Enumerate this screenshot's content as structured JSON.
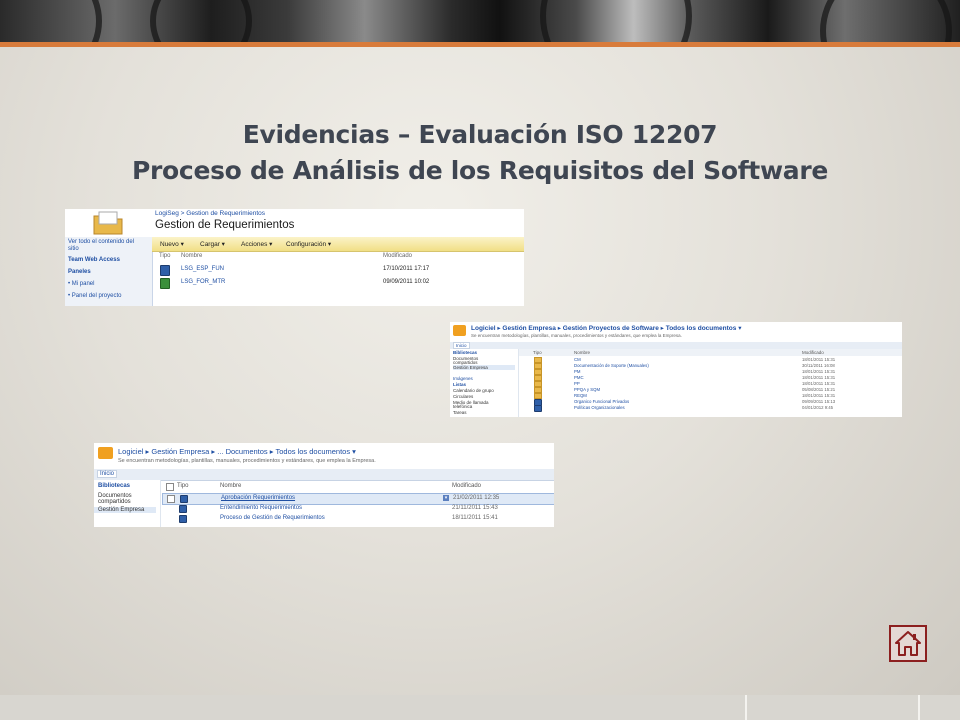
{
  "slide": {
    "title_line1": "Evidencias – Evaluación ISO 12207",
    "title_line2": "Proceso de Análisis de los Requisitos del Software"
  },
  "colors": {
    "accent_line": "#d87b3b",
    "title_text": "#3f4652",
    "home_border": "#8c1f1f"
  },
  "screenshot1": {
    "breadcrumb": "LogiSeg > Gestion de Requerimientos",
    "page_title": "Gestion de Requerimientos",
    "toolbar": [
      "Nuevo ▾",
      "Cargar ▾",
      "Acciones ▾",
      "Configuración ▾"
    ],
    "nav": [
      "Ver todo el contenido del",
      "sitio",
      "Team Web Access",
      "Paneles",
      "• Mi panel",
      "• Panel del proyecto"
    ],
    "columns": [
      "Tipo",
      "Nombre",
      "Modificado"
    ],
    "rows": [
      {
        "icon": "word-doc-icon",
        "name": "LSG_ESP_FUN",
        "modified": "17/10/2011 17:17"
      },
      {
        "icon": "excel-doc-icon",
        "name": "LSG_FOR_MTR",
        "modified": "09/09/2011 10:02"
      }
    ]
  },
  "screenshot2": {
    "breadcrumb": "Logiciel ▸ Gestión Empresa ▸ Gestión Proyectos de Software ▸ Todos los documentos ▾",
    "subtitle": "Se encuentran metodologías, plantillas, manuales, procedimientos y estándares, que emplea la Empresa.",
    "tab": "Inicio",
    "nav": [
      "Bibliotecas",
      "Documentos",
      "compartidos",
      "Gestión Empresa",
      "Imágenes",
      "Listas",
      "Calendario de grupo",
      "Circulares",
      "Medio de llamada",
      "telefónica",
      "Tareas"
    ],
    "columns": [
      "Tipo",
      "Nombre",
      "Modificado"
    ],
    "rows": [
      {
        "name": "CM",
        "modified": "18/01/2011 15:31"
      },
      {
        "name": "Documentación de Soporte (Manuales)",
        "modified": "30/11/2011 16:08"
      },
      {
        "name": "PM",
        "modified": "18/01/2011 15:31"
      },
      {
        "name": "PMC",
        "modified": "18/01/2011 15:31"
      },
      {
        "name": "PP",
        "modified": "18/01/2011 15:31"
      },
      {
        "name": "PPQA y SQM",
        "modified": "05/08/2011 15:21"
      },
      {
        "name": "REQM",
        "modified": "18/01/2011 15:31"
      },
      {
        "name": "Organico Funcional Privados",
        "modified": "09/09/2011 15:13"
      },
      {
        "name": "Políticas Organizacionales",
        "modified": "04/01/2012 9:45"
      }
    ]
  },
  "screenshot3": {
    "breadcrumb": "Logiciel ▸ Gestión Empresa ▸ ... Documentos ▸ Todos los documentos ▾",
    "subtitle": "Se encuentran metodologías, plantillas, manuales, procedimientos y estándares, que emplea la Empresa.",
    "tab": "Inicio",
    "nav": [
      "Bibliotecas",
      "Documentos",
      "compartidos",
      "Gestión Empresa"
    ],
    "columns": [
      "Tipo",
      "Nombre",
      "Modificado"
    ],
    "rows": [
      {
        "name": "Aprobación Requerimientos",
        "modified": "21/02/2011 12:35"
      },
      {
        "name": "Entendimiento Requerimientos",
        "modified": "21/11/2011 15:43"
      },
      {
        "name": "Proceso de Gestión de Requerimientos",
        "modified": "18/11/2011 15:41"
      }
    ]
  },
  "home_button": {
    "icon": "home-icon"
  }
}
